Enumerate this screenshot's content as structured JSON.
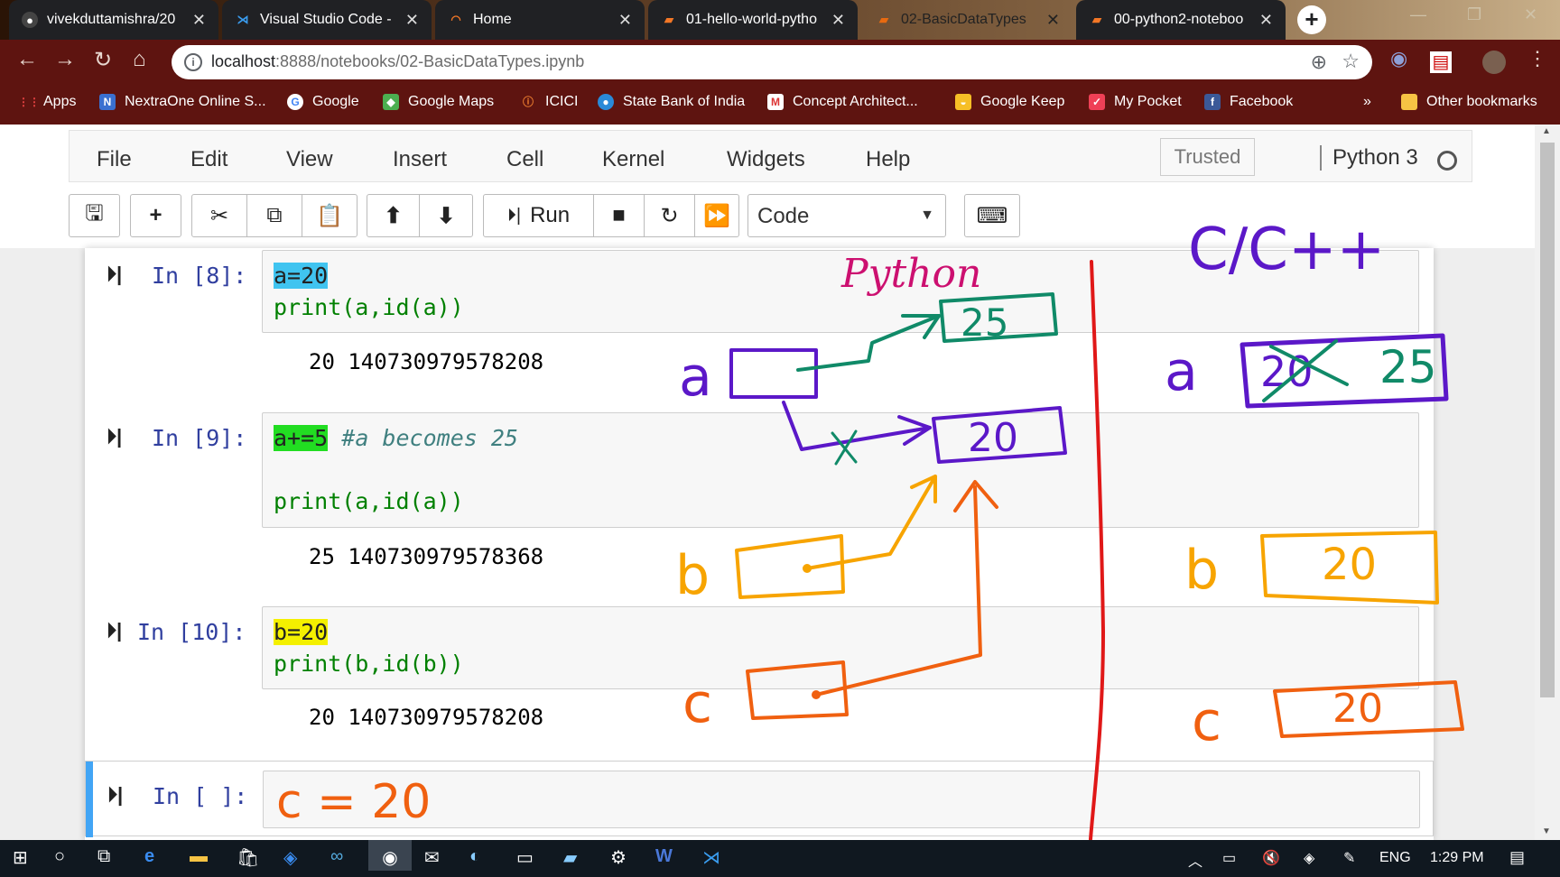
{
  "browser": {
    "tabs": [
      {
        "label": "vivekduttamishra/20",
        "icon": "github-icon"
      },
      {
        "label": "Visual Studio Code -",
        "icon": "vscode-icon"
      },
      {
        "label": "Home",
        "icon": "jupyter-icon"
      },
      {
        "label": "01-hello-world-pytho",
        "icon": "notebook-icon"
      },
      {
        "label": "02-BasicDataTypes",
        "icon": "notebook-icon",
        "active": true
      },
      {
        "label": "00-python2-noteboo",
        "icon": "notebook-icon"
      }
    ],
    "url_host": "localhost",
    "url_rest": ":8888/notebooks/02-BasicDataTypes.ipynb",
    "bookmarks": [
      {
        "label": "Apps",
        "icon": "apps-grid-icon"
      },
      {
        "label": "NextraOne Online S...",
        "icon": "nextraone-icon"
      },
      {
        "label": "Google",
        "icon": "google-icon"
      },
      {
        "label": "Google Maps",
        "icon": "maps-icon"
      },
      {
        "label": "ICICI",
        "icon": "icici-icon"
      },
      {
        "label": "State Bank of India",
        "icon": "sbi-icon"
      },
      {
        "label": "Concept Architect...",
        "icon": "gmail-icon"
      },
      {
        "label": "Google Keep",
        "icon": "keep-icon"
      },
      {
        "label": "My Pocket",
        "icon": "pocket-icon"
      },
      {
        "label": "Facebook",
        "icon": "facebook-icon"
      }
    ],
    "bookmarks_overflow": "»",
    "other_bookmarks": "Other bookmarks"
  },
  "notebook": {
    "menus": [
      "File",
      "Edit",
      "View",
      "Insert",
      "Cell",
      "Kernel",
      "Widgets",
      "Help"
    ],
    "trusted": "Trusted",
    "kernel": "Python 3",
    "run_label": "Run",
    "cell_type": "Code",
    "cells": [
      {
        "prompt": "In [8]:",
        "line1_hl": "a=20",
        "line2": "print(a,id(a))",
        "output": "20 140730979578208"
      },
      {
        "prompt": "In [9]:",
        "line1_hl": "a+=5",
        "comment": "#a becomes 25",
        "line2": "print(a,id(a))",
        "output": "25 140730979578368"
      },
      {
        "prompt": "In [10]:",
        "line1_hl": "b=20",
        "line2": "print(b,id(b))",
        "output": "20 140730979578208"
      },
      {
        "prompt": "In [ ]:"
      }
    ]
  },
  "annotations": {
    "python_label": "Python",
    "cpp_label": "C/C++",
    "var_a": "a",
    "var_b": "b",
    "var_c": "c",
    "box_25": "25",
    "box_20": "20",
    "cell_input": "c = 20",
    "colors": {
      "purple": "#5b18c8",
      "teal": "#108a68",
      "orange": "#f7a400",
      "red": "#f06010",
      "magenta": "#cc1070",
      "divider": "#e01818"
    }
  },
  "taskbar": {
    "language": "ENG",
    "time": "1:29 PM"
  }
}
